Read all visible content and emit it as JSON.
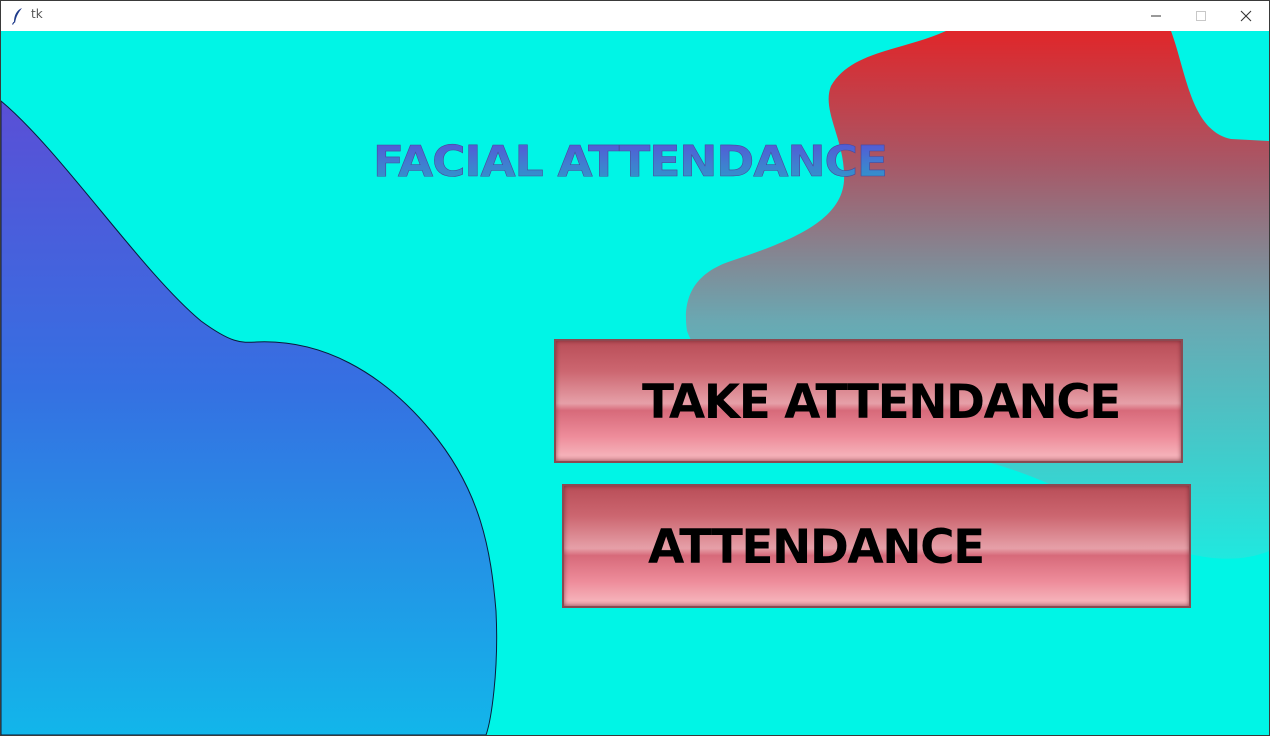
{
  "window": {
    "title": "tk",
    "icon": "tk-feather-icon",
    "controls": [
      "minimize-icon",
      "maximize-icon",
      "close-icon"
    ]
  },
  "heading": {
    "text": "FACIAL ATTENDANCE",
    "gradient": [
      "#5b4ed8",
      "#8a5ad0",
      "#c2306a"
    ]
  },
  "buttons": {
    "take_attendance": "TAKE ATTENDANCE",
    "attendance": "ATTENDANCE"
  },
  "colors": {
    "background": "#00f5e6",
    "left_blob_top": "#5a4fd6",
    "left_blob_bottom": "#12b6ea",
    "right_blob_top": "#e0262a",
    "right_blob_bottom": "#20e8df",
    "button_fill": "#ee8d9b"
  }
}
